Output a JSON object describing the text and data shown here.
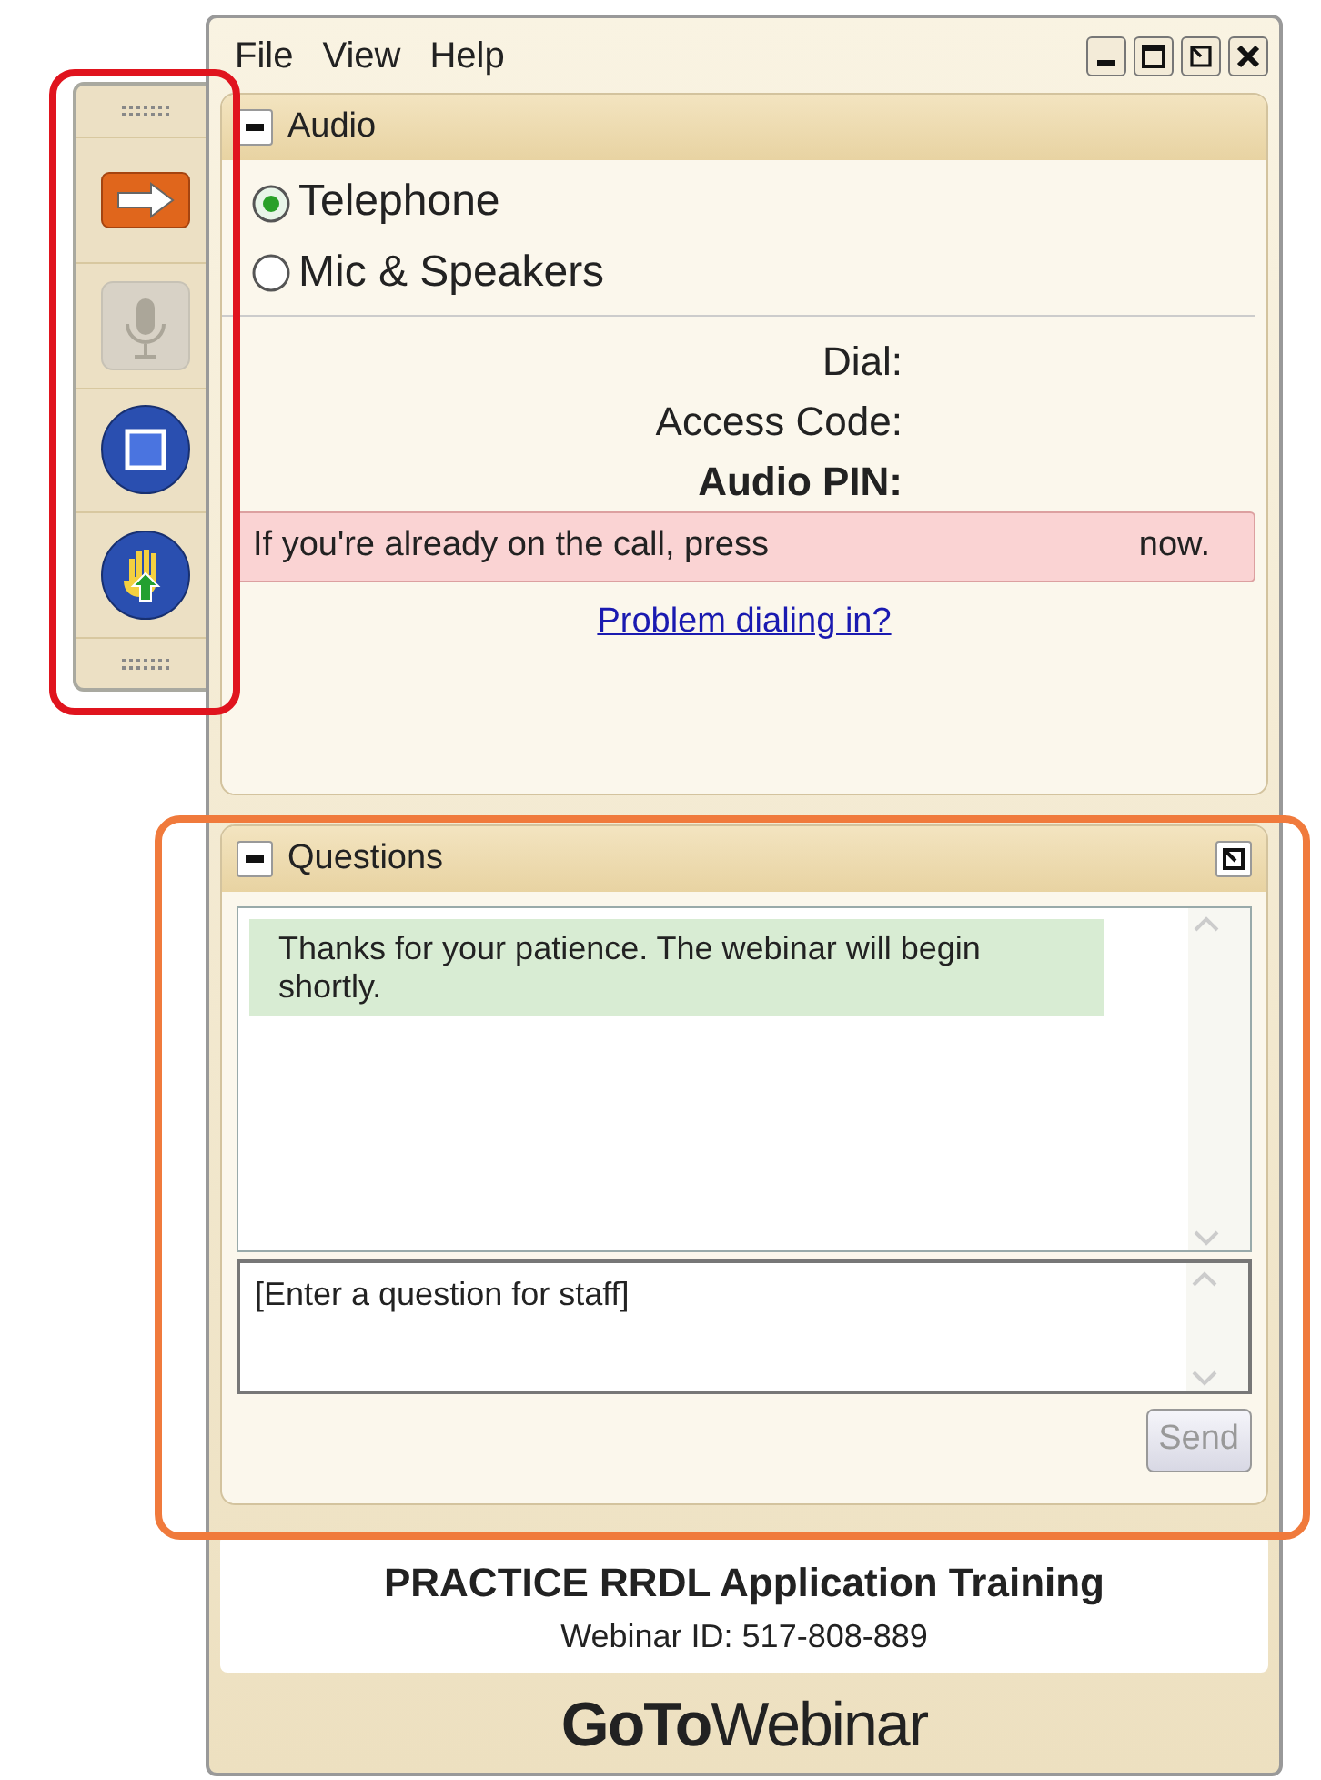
{
  "toolbar": {
    "buttons": [
      {
        "kind": "arrow",
        "disabled": false
      },
      {
        "kind": "mic",
        "disabled": true
      },
      {
        "kind": "screen",
        "disabled": false
      },
      {
        "kind": "hand",
        "disabled": false
      }
    ]
  },
  "menu": [
    "File",
    "View",
    "Help"
  ],
  "audio": {
    "title": "Audio",
    "options": [
      {
        "label": "Telephone",
        "selected": true
      },
      {
        "label": "Mic & Speakers",
        "selected": false
      }
    ],
    "fields": [
      {
        "label": "Dial:",
        "bold": false
      },
      {
        "label": "Access Code:",
        "bold": false
      },
      {
        "label": "Audio PIN:",
        "bold": true
      }
    ],
    "notice": [
      "If you're already on the call, press",
      "now."
    ],
    "link": "Problem dialing in?"
  },
  "questions": {
    "title": "Questions",
    "messages": [
      "Thanks for your patience.  The webinar will begin shortly."
    ],
    "placeholder": "[Enter a question for staff]",
    "send": {
      "label": "Send",
      "disabled": true
    }
  },
  "footer": {
    "title": "PRACTICE RRDL Application Training",
    "webinar_id": "Webinar ID: 517-808-889",
    "logo": "**GoTo**Webinar"
  },
  "highlights": [
    {
      "color": "#e0141e"
    },
    {
      "color": "#f07a3c"
    }
  ]
}
